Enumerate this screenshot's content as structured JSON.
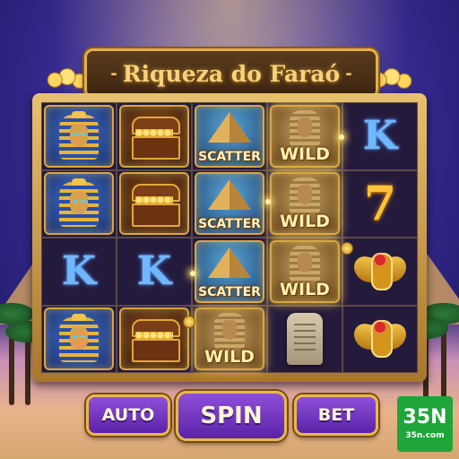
{
  "title": {
    "text": "Riqueza do Faraó",
    "left_deco": "-",
    "right_deco": "-"
  },
  "reels": {
    "columns": [
      {
        "cells": [
          {
            "symbol": "pharaoh",
            "icon": "pharaoh-mask-icon"
          },
          {
            "symbol": "pharaoh",
            "icon": "pharaoh-mask-icon"
          },
          {
            "symbol": "letter",
            "text": "K"
          },
          {
            "symbol": "pharaoh",
            "icon": "pharaoh-mask-icon"
          }
        ]
      },
      {
        "cells": [
          {
            "symbol": "chest",
            "icon": "treasure-chest-icon"
          },
          {
            "symbol": "chest",
            "icon": "treasure-chest-icon"
          },
          {
            "symbol": "letter",
            "text": "K"
          },
          {
            "symbol": "chest",
            "icon": "treasure-chest-icon"
          }
        ]
      },
      {
        "cells": [
          {
            "symbol": "scatter",
            "icon": "pyramid-icon",
            "label": "SCATTER"
          },
          {
            "symbol": "scatter",
            "icon": "pyramid-icon",
            "label": "SCATTER"
          },
          {
            "symbol": "scatter",
            "icon": "pyramid-icon",
            "label": "SCATTER"
          },
          {
            "symbol": "wild",
            "icon": "sphinx-icon",
            "label": "WILD"
          }
        ]
      },
      {
        "cells": [
          {
            "symbol": "wild",
            "icon": "sphinx-icon",
            "label": "WILD"
          },
          {
            "symbol": "wild",
            "icon": "sphinx-icon",
            "label": "WILD"
          },
          {
            "symbol": "wild",
            "icon": "sphinx-icon",
            "label": "WILD"
          },
          {
            "symbol": "tablet",
            "icon": "stone-tablet-icon"
          }
        ]
      },
      {
        "cells": [
          {
            "symbol": "letter",
            "text": "K"
          },
          {
            "symbol": "seven",
            "text": "7"
          },
          {
            "symbol": "scarab",
            "icon": "scarab-icon"
          },
          {
            "symbol": "scarab",
            "icon": "scarab-icon"
          }
        ]
      }
    ]
  },
  "buttons": {
    "auto": "AUTO",
    "spin": "SPIN",
    "bet": "BET"
  },
  "brand": {
    "logo_text": "35N",
    "domain": "35n.com"
  },
  "colors": {
    "gold": "#e6b84e",
    "button_purple": "#7a38c8",
    "badge_green": "#1fa63a"
  }
}
